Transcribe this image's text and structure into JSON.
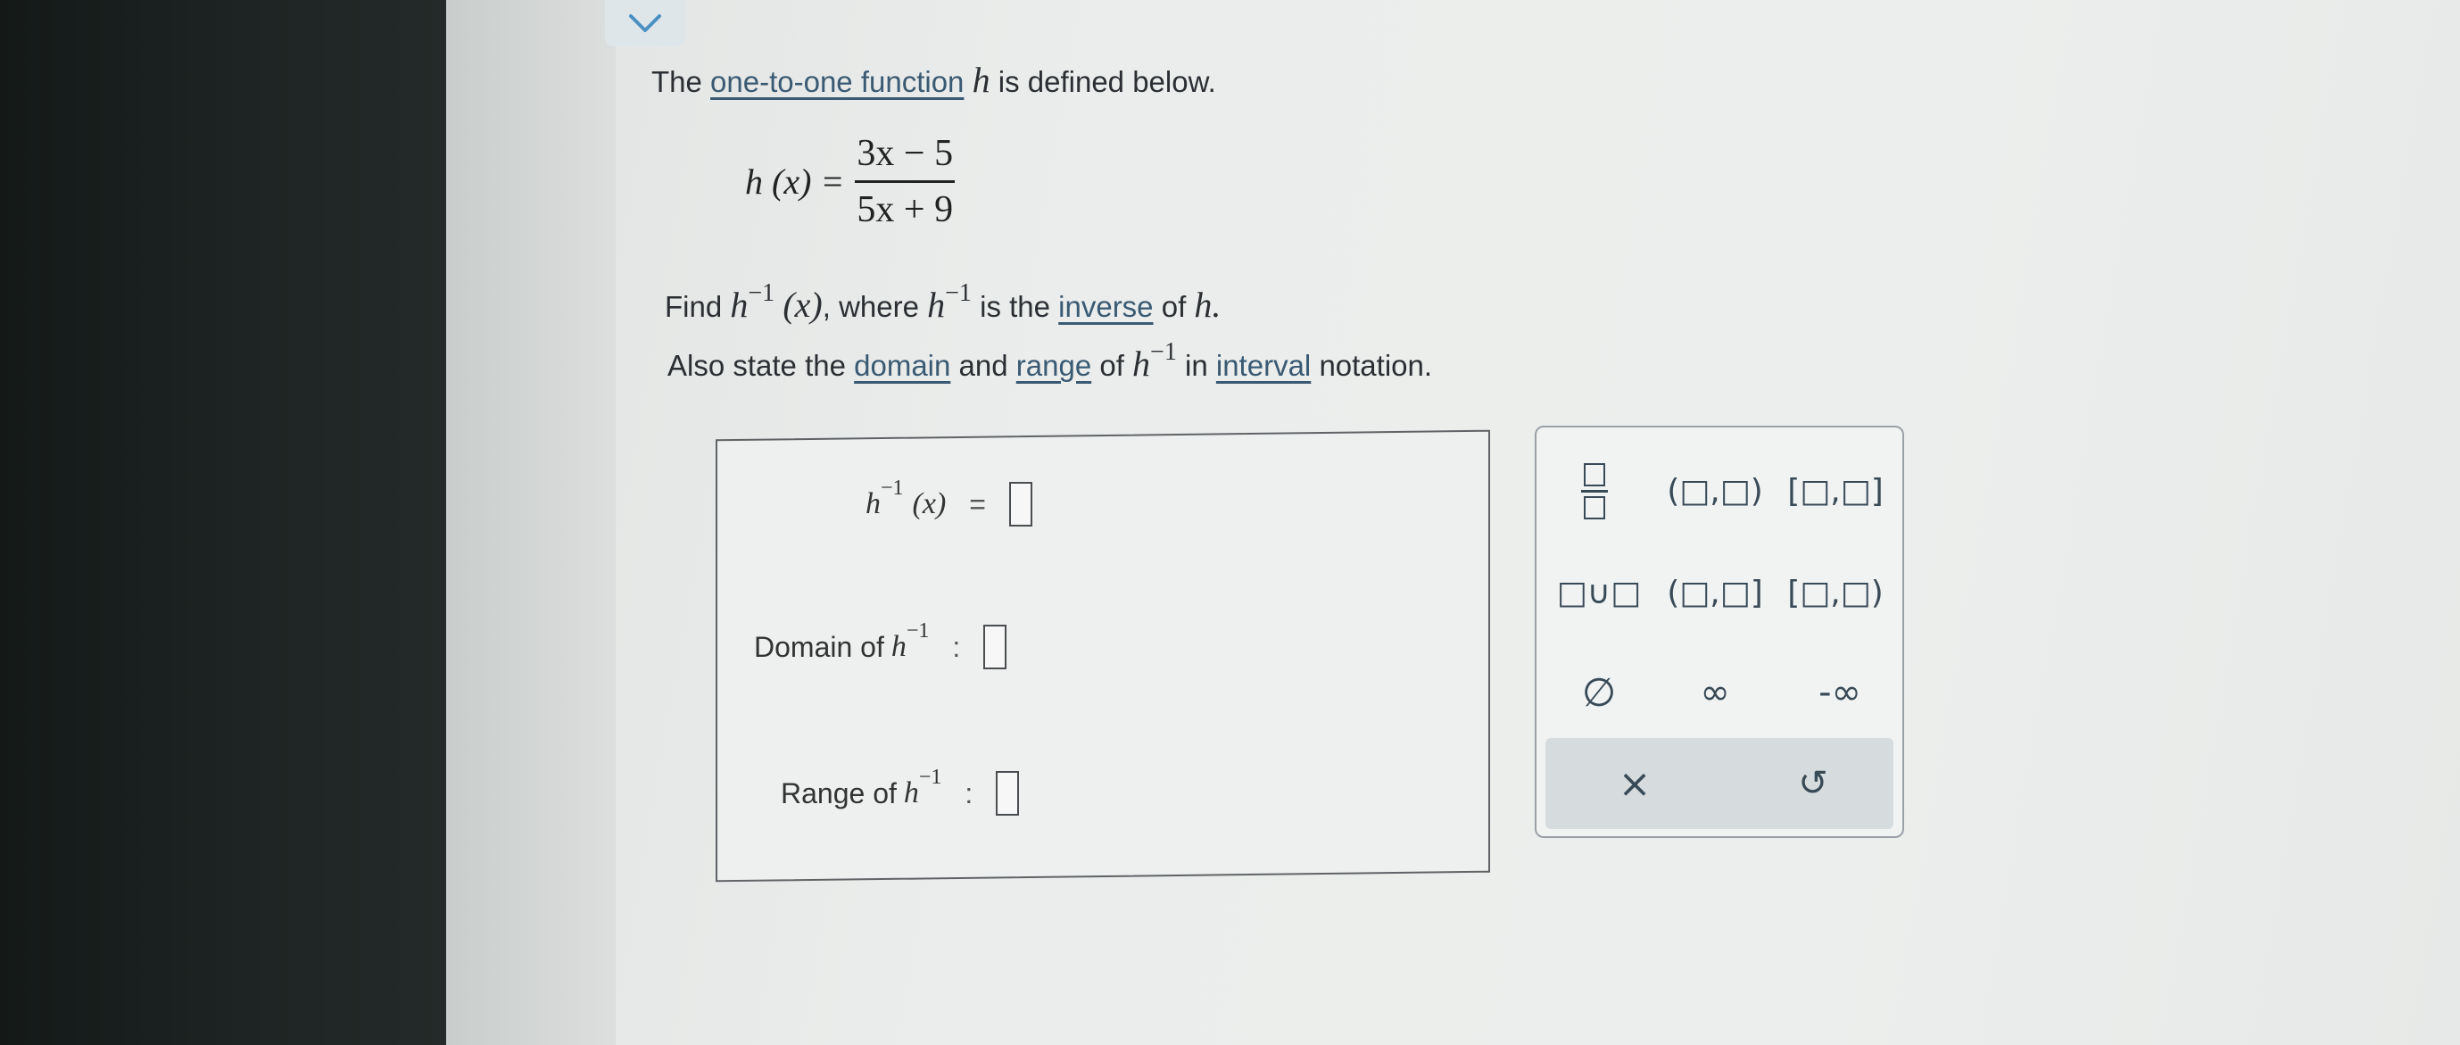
{
  "prompt": {
    "line1_prefix": "The",
    "line1_link": "one-to-one function",
    "line1_var": "h",
    "line1_suffix": "is defined below.",
    "equation_lhs": "h (x) =",
    "equation_num": "3x − 5",
    "equation_den": "5x + 9",
    "line2_prefix": "Find",
    "line2_var": "h",
    "line2_sup": "−1",
    "line2_arg": "(x)",
    "line2_mid": ", where",
    "line2_var2": "h",
    "line2_sup2": "−1",
    "line2_is": "is the",
    "line2_link": "inverse",
    "line2_of": "of",
    "line2_var3": "h.",
    "line3_prefix": "Also state the",
    "line3_link1": "domain",
    "line3_and": "and",
    "line3_link2": "range",
    "line3_of": "of",
    "line3_var": "h",
    "line3_sup": "−1",
    "line3_in": "in",
    "line3_link3": "interval",
    "line3_suffix": "notation."
  },
  "answers": {
    "inverse_var": "h",
    "inverse_sup": "−1",
    "inverse_arg": "(x)",
    "inverse_eq": "=",
    "domain_label": "Domain of",
    "domain_var": "h",
    "domain_sup": "−1",
    "domain_sep": ":",
    "range_label": "Range of",
    "range_var": "h",
    "range_sup": "−1",
    "range_sep": ":"
  },
  "keypad": {
    "open_open": "(□,□)",
    "closed_closed": "[□,□]",
    "union": "□∪□",
    "open_closed": "(□,□]",
    "closed_open": "[□,□)",
    "empty_set": "∅",
    "infinity": "∞",
    "neg_infinity": "-∞",
    "clear": "×",
    "undo": "↺"
  },
  "colors": {
    "link": "#3a5a73",
    "key_text": "#394a57",
    "collapse_chevron": "#4a90c2"
  },
  "icons": {
    "collapse": "chevron-down-icon",
    "fraction": "fraction-icon",
    "clear": "close-icon",
    "undo": "undo-icon"
  }
}
